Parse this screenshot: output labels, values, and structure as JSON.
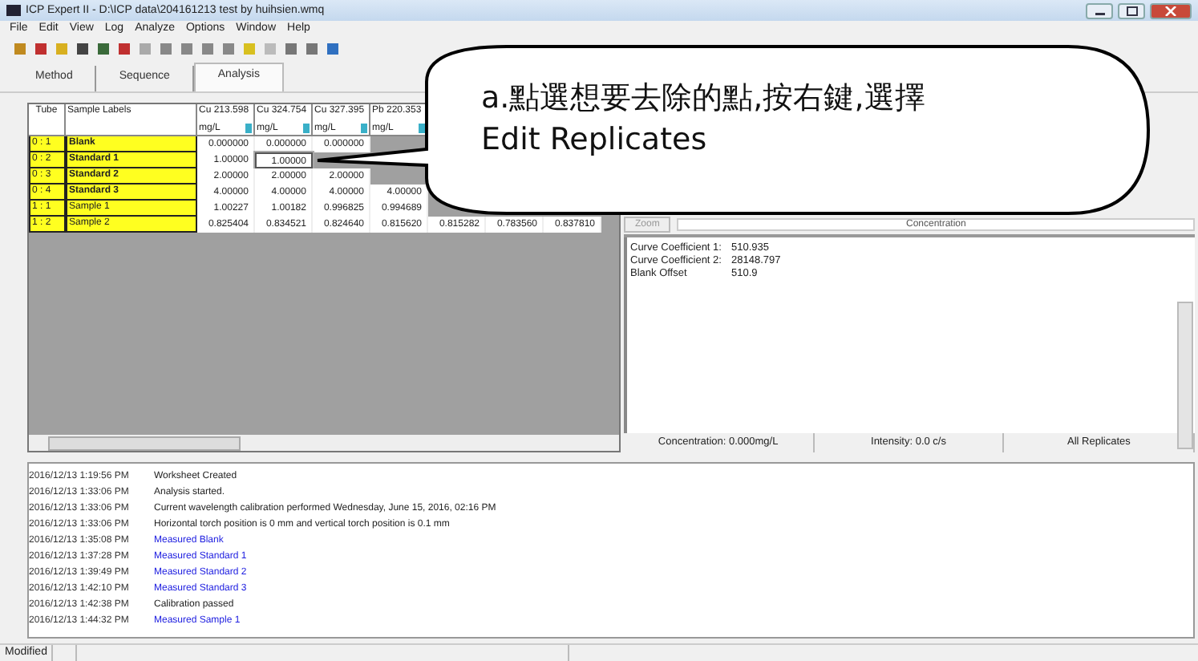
{
  "window": {
    "title": "ICP Expert II - D:\\ICP data\\204161213 test by huihsien.wmq"
  },
  "menu": [
    "File",
    "Edit",
    "View",
    "Log",
    "Analyze",
    "Options",
    "Window",
    "Help"
  ],
  "tabs": [
    {
      "label": "Method",
      "selected": false
    },
    {
      "label": "Sequence",
      "selected": false
    },
    {
      "label": "Analysis",
      "selected": true
    }
  ],
  "table": {
    "columns": [
      "Tube",
      "Sample Labels"
    ],
    "data_columns": [
      {
        "name": "Cu 213.598",
        "unit": "mg/L"
      },
      {
        "name": "Cu 324.754",
        "unit": "mg/L"
      },
      {
        "name": "Cu 327.395",
        "unit": "mg/L"
      },
      {
        "name": "Pb 220.353",
        "unit": "mg/L"
      }
    ],
    "rows": [
      {
        "tube": "0 : 1",
        "label": "Blank",
        "kind": "standard",
        "cells": [
          {
            "value": "0.000000",
            "selected": false
          },
          {
            "value": "0.000000",
            "selected": false
          },
          {
            "value": "0.000000",
            "selected": false
          }
        ]
      },
      {
        "tube": "0 : 2",
        "label": "Standard 1",
        "kind": "standard",
        "cells": [
          {
            "value": "1.00000",
            "selected": false
          },
          {
            "value": "1.00000",
            "selected": true
          }
        ]
      },
      {
        "tube": "0 : 3",
        "label": "Standard 2",
        "kind": "standard",
        "cells": [
          {
            "value": "2.00000",
            "selected": false
          },
          {
            "value": "2.00000",
            "selected": false
          },
          {
            "value": "2.00000",
            "selected": false
          }
        ]
      },
      {
        "tube": "0 : 4",
        "label": "Standard 3",
        "kind": "standard",
        "cells": [
          {
            "value": "4.00000",
            "selected": false
          },
          {
            "value": "4.00000",
            "selected": false
          },
          {
            "value": "4.00000",
            "selected": false
          },
          {
            "value": "4.00000",
            "selected": false
          }
        ]
      },
      {
        "tube": "1 : 1",
        "label": "Sample 1",
        "kind": "sample",
        "cells": [
          {
            "value": "1.00227",
            "selected": false
          },
          {
            "value": "1.00182",
            "selected": false
          },
          {
            "value": "0.996825",
            "selected": false
          },
          {
            "value": "0.994689",
            "selected": false
          }
        ]
      },
      {
        "tube": "1 : 2",
        "label": "Sample 2",
        "kind": "sample",
        "cells": [
          {
            "value": "0.825404",
            "selected": false
          },
          {
            "value": "0.834521",
            "selected": false
          },
          {
            "value": "0.824640",
            "selected": false
          },
          {
            "value": "0.815620",
            "selected": false
          },
          {
            "value": "0.815282",
            "selected": false
          },
          {
            "value": "0.783560",
            "selected": false
          },
          {
            "value": "0.837810",
            "selected": false
          }
        ]
      }
    ]
  },
  "callout": {
    "lines": [
      "a.點選想要去除的點,按右鍵,選擇",
      "Edit Replicates"
    ]
  },
  "results_panel": {
    "zoom_button": "Zoom",
    "dropdown": "Concentration",
    "results": [
      {
        "label": "Curve Coefficient 1:",
        "value": "510.935"
      },
      {
        "label": "Curve Coefficient 2:",
        "value": "28148.797"
      },
      {
        "label": "Blank Offset",
        "value": "510.9"
      }
    ],
    "status": [
      "Concentration: 0.000mg/L",
      "Intensity: 0.0 c/s",
      "All Replicates"
    ]
  },
  "log": [
    {
      "time": "2016/12/13 1:19:56 PM",
      "message": "Worksheet Created",
      "kind": "info"
    },
    {
      "time": "2016/12/13 1:33:06 PM",
      "message": "Analysis started.",
      "kind": "info"
    },
    {
      "time": "2016/12/13 1:33:06 PM",
      "message": "Current wavelength calibration performed Wednesday, June 15, 2016, 02:16 PM",
      "kind": "info"
    },
    {
      "time": "2016/12/13 1:33:06 PM",
      "message": "Horizontal torch position is 0 mm and vertical torch position is 0.1 mm",
      "kind": "info"
    },
    {
      "time": "2016/12/13 1:35:08 PM",
      "message": "Measured Blank",
      "kind": "measurement"
    },
    {
      "time": "2016/12/13 1:37:28 PM",
      "message": "Measured Standard 1",
      "kind": "measurement"
    },
    {
      "time": "2016/12/13 1:39:49 PM",
      "message": "Measured Standard 2",
      "kind": "measurement"
    },
    {
      "time": "2016/12/13 1:42:10 PM",
      "message": "Measured Standard 3",
      "kind": "measurement"
    },
    {
      "time": "2016/12/13 1:42:38 PM",
      "message": "Calibration passed",
      "kind": "info"
    },
    {
      "time": "2016/12/13 1:44:32 PM",
      "message": "Measured Sample 1",
      "kind": "measurement"
    }
  ],
  "status_bar": "Modified"
}
